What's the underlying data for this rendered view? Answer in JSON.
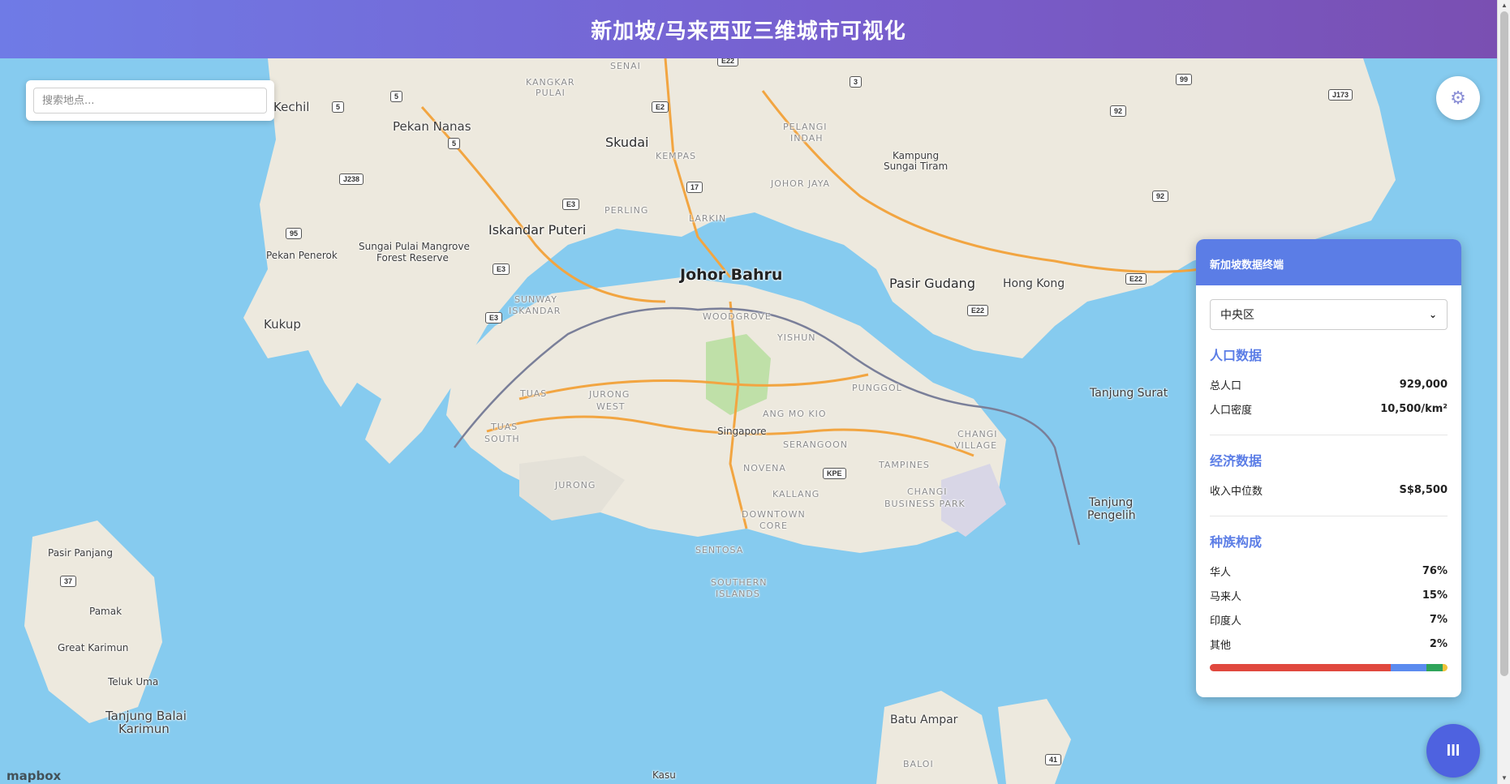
{
  "header": {
    "title": "新加坡/马来西亚三维城市可视化"
  },
  "search": {
    "placeholder": "搜索地点..."
  },
  "settings": {
    "icon": "gear-icon"
  },
  "panel": {
    "title": "新加坡数据终端",
    "selected_district": "中央区",
    "population": {
      "title": "人口数据",
      "total_label": "总人口",
      "total_value": "929,000",
      "density_label": "人口密度",
      "density_value": "10,500/km²"
    },
    "economy": {
      "title": "经济数据",
      "income_label": "收入中位数",
      "income_value": "S$8,500"
    },
    "ethnicity": {
      "title": "种族构成",
      "items": [
        {
          "label": "华人",
          "value": "76%",
          "percent": 76,
          "color": "#e0483e"
        },
        {
          "label": "马来人",
          "value": "15%",
          "percent": 15,
          "color": "#5b8bef"
        },
        {
          "label": "印度人",
          "value": "7%",
          "percent": 7,
          "color": "#2fa45a"
        },
        {
          "label": "其他",
          "value": "2%",
          "percent": 2,
          "color": "#f0c23a"
        }
      ]
    }
  },
  "layers_button": {
    "icon": "bars-icon",
    "label": "III"
  },
  "map": {
    "attribution": "mapbox",
    "labels": {
      "johor_bahru": "Johor Bahru",
      "iskandar_puteri": "Iskandar Puteri",
      "skudai": "Skudai",
      "pasir_gudang": "Pasir Gudang",
      "hong_kong": "Hong Kong",
      "pekan_nanas": "Pekan Nanas",
      "kechil": "Kechil",
      "kukup": "Kukup",
      "pekan_penerok": "Pekan Penerok",
      "sungai_pulai": "Sungai Pulai Mangrove",
      "forest_reserve": "Forest Reserve",
      "kampung": "Kampung",
      "sungai_tiram": "Sungai Tiram",
      "tanjung_surat": "Tanjung Surat",
      "tanjung": "Tanjung",
      "pengelih": "Pengelih",
      "singapore": "Singapore",
      "pasir_panjang": "Pasir Panjang",
      "pamak": "Pamak",
      "great_karimun": "Great Karimun",
      "teluk_uma": "Teluk Uma",
      "tanjung_balai": "Tanjung Balai",
      "karimun": "Karimun",
      "batu_ampar": "Batu Ampar",
      "baloi": "BALOI",
      "kasu": "Kasu",
      "senai": "SENAI",
      "kangkar": "KANGKAR",
      "pulai": "PULAI",
      "kempas": "KEMPAS",
      "pelangi": "PELANGI",
      "indah": "INDAH",
      "johor_jaya": "JOHOR JAYA",
      "perling": "PERLING",
      "larkin": "LARKIN",
      "sunway": "SUNWAY",
      "iskandar": "ISKANDAR",
      "woodgrove": "WOODGROVE",
      "yishun": "YISHUN",
      "punggol": "PUNGGOL",
      "jurong": "JURONG",
      "west": "WEST",
      "tuas": "TUAS",
      "tuas_south": "TUAS",
      "south": "SOUTH",
      "jurong_island": "JURONG",
      "ang_mo_kio": "ANG MO KIO",
      "serangoon": "SERANGOON",
      "novena": "NOVENA",
      "kallang": "KALLANG",
      "tampines": "TAMPINES",
      "changi": "CHANGI",
      "business_park": "BUSINESS PARK",
      "changi_v": "CHANGI",
      "village": "VILLAGE",
      "downtown": "DOWNTOWN",
      "core": "CORE",
      "sentosa": "SENTOSA",
      "southern": "SOUTHERN",
      "islands": "ISLANDS"
    },
    "shields": {
      "e22a": "E22",
      "e2": "E2",
      "r3": "3",
      "r5a": "5",
      "r5b": "5",
      "r5c": "5",
      "j238": "J238",
      "e3a": "E3",
      "r17": "17",
      "r95": "95",
      "e3b": "E3",
      "e3c": "E3",
      "r99": "99",
      "j173": "J173",
      "r92a": "92",
      "r92b": "92",
      "e22b": "E22",
      "e22c": "E22",
      "kpe": "KPE",
      "r37": "37",
      "r41": "41"
    }
  }
}
